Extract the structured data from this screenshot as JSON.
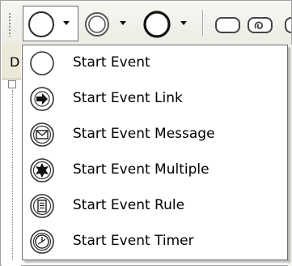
{
  "toolbar": {
    "buttons": [
      {
        "icon": "start-event-icon",
        "has_dropdown": true,
        "active": true
      },
      {
        "icon": "intermediate-event-icon",
        "has_dropdown": true,
        "active": false
      },
      {
        "icon": "end-event-icon",
        "has_dropdown": true,
        "active": false
      },
      {
        "icon": "task-icon",
        "has_dropdown": false,
        "active": false
      },
      {
        "icon": "subprocess-icon",
        "has_dropdown": false,
        "active": false
      }
    ]
  },
  "background_window": {
    "tab_letter": "D"
  },
  "menu": {
    "items": [
      {
        "label": "Start Event",
        "icon": "start-event-icon"
      },
      {
        "label": "Start Event Link",
        "icon": "link-arrow-icon"
      },
      {
        "label": "Start Event Message",
        "icon": "message-envelope-icon"
      },
      {
        "label": "Start Event Multiple",
        "icon": "multiple-star-icon"
      },
      {
        "label": "Start Event Rule",
        "icon": "rule-document-icon"
      },
      {
        "label": "Start Event Timer",
        "icon": "timer-clock-icon"
      }
    ]
  },
  "colors": {
    "toolbar_bg": "#ecebe4",
    "menu_border": "#6f6f6f",
    "icon_stroke": "#333333"
  }
}
